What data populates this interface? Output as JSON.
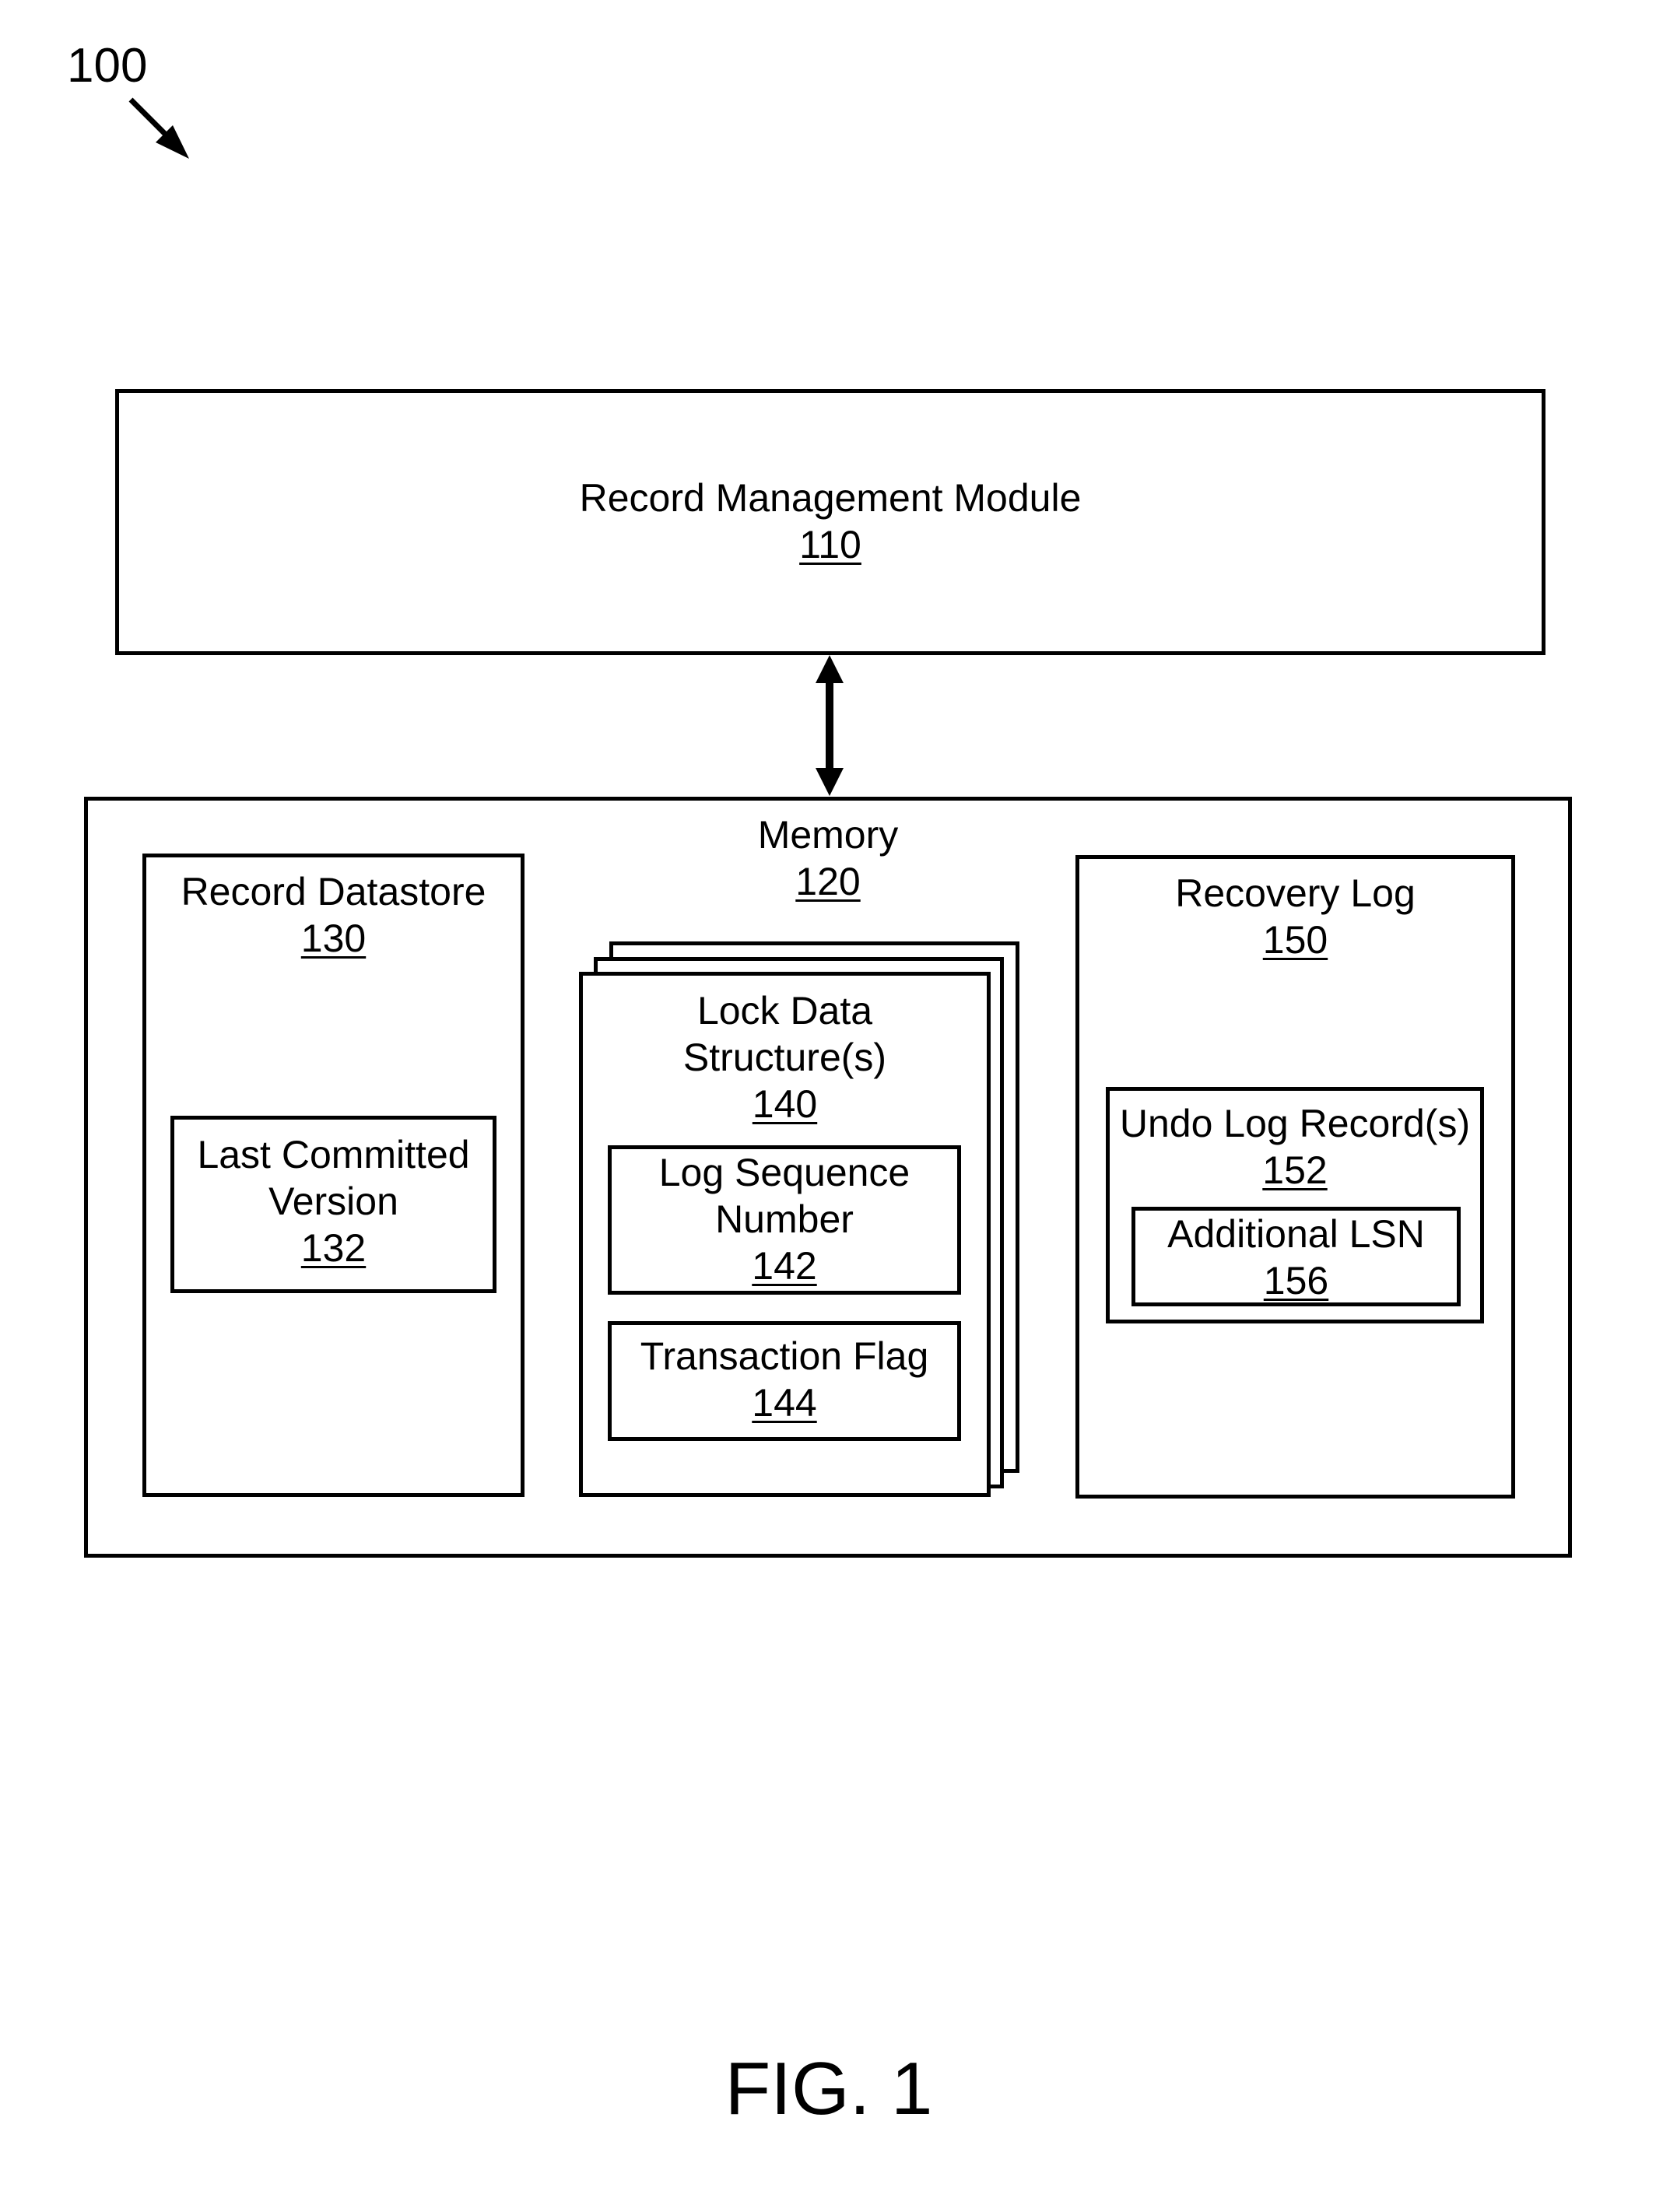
{
  "figure": {
    "reference_number": "100",
    "caption": "FIG. 1"
  },
  "components": {
    "record_management_module": {
      "name": "Record Management Module",
      "ref": "110"
    },
    "memory": {
      "name": "Memory",
      "ref": "120"
    },
    "record_datastore": {
      "name": "Record Datastore",
      "ref": "130"
    },
    "last_committed_version": {
      "name_line1": "Last Committed",
      "name_line2": "Version",
      "ref": "132"
    },
    "lock_data_structures": {
      "name_line1": "Lock Data",
      "name_line2": "Structure(s)",
      "ref": "140"
    },
    "log_sequence_number": {
      "name_line1": "Log Sequence",
      "name_line2": "Number",
      "ref": "142"
    },
    "transaction_flag": {
      "name": "Transaction Flag",
      "ref": "144"
    },
    "recovery_log": {
      "name": "Recovery Log",
      "ref": "150"
    },
    "undo_log_records": {
      "name": "Undo Log Record(s)",
      "ref": "152"
    },
    "additional_lsn": {
      "name": "Additional LSN",
      "ref": "156"
    }
  },
  "connections": [
    {
      "from": "record_management_module",
      "to": "memory",
      "type": "bidirectional-arrow"
    }
  ]
}
